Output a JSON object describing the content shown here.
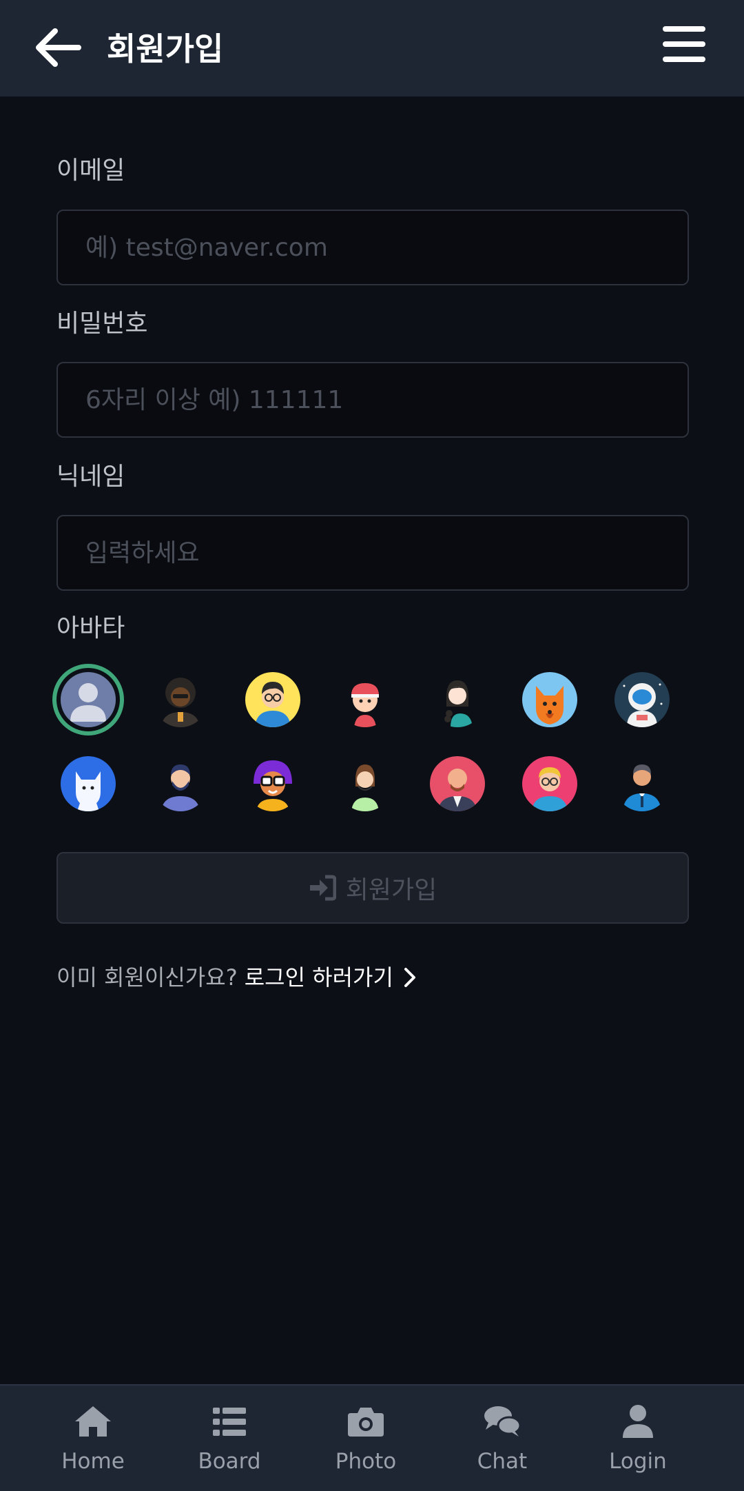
{
  "header": {
    "title": "회원가입",
    "back_icon": "arrow-left-icon",
    "menu_icon": "hamburger-menu-icon"
  },
  "form": {
    "email_label": "이메일",
    "email_placeholder": "예) test@naver.com",
    "password_label": "비밀번호",
    "password_placeholder": "6자리 이상 예) 111111",
    "nickname_label": "닉네임",
    "nickname_placeholder": "입력하세요",
    "avatar_label": "아바타",
    "selected_avatar_index": 0,
    "avatars": [
      "default-user-avatar",
      "man-afro-sunglasses-avatar",
      "woman-glasses-yellow-avatar",
      "kid-cap-avatar",
      "woman-braid-avatar",
      "fox-avatar",
      "astronaut-avatar",
      "white-cat-avatar",
      "bearded-man-avatar",
      "purple-hair-glasses-avatar",
      "woman-green-shirt-avatar",
      "bald-man-avatar",
      "blonde-glasses-avatar",
      "businessman-avatar"
    ],
    "submit_label": "회원가입",
    "submit_icon": "sign-in-icon"
  },
  "login_prompt": {
    "question": "이미 회원이신가요?",
    "link_label": "로그인 하러가기",
    "link_icon": "chevron-right-icon"
  },
  "bottom_nav": [
    {
      "label": "Home",
      "icon": "home-icon"
    },
    {
      "label": "Board",
      "icon": "list-icon"
    },
    {
      "label": "Photo",
      "icon": "camera-icon"
    },
    {
      "label": "Chat",
      "icon": "chat-bubbles-icon"
    },
    {
      "label": "Login",
      "icon": "user-icon"
    }
  ],
  "colors": {
    "header_bg": "#1e2533",
    "page_bg": "#0c0f15",
    "selected_ring": "#3fa77a"
  }
}
